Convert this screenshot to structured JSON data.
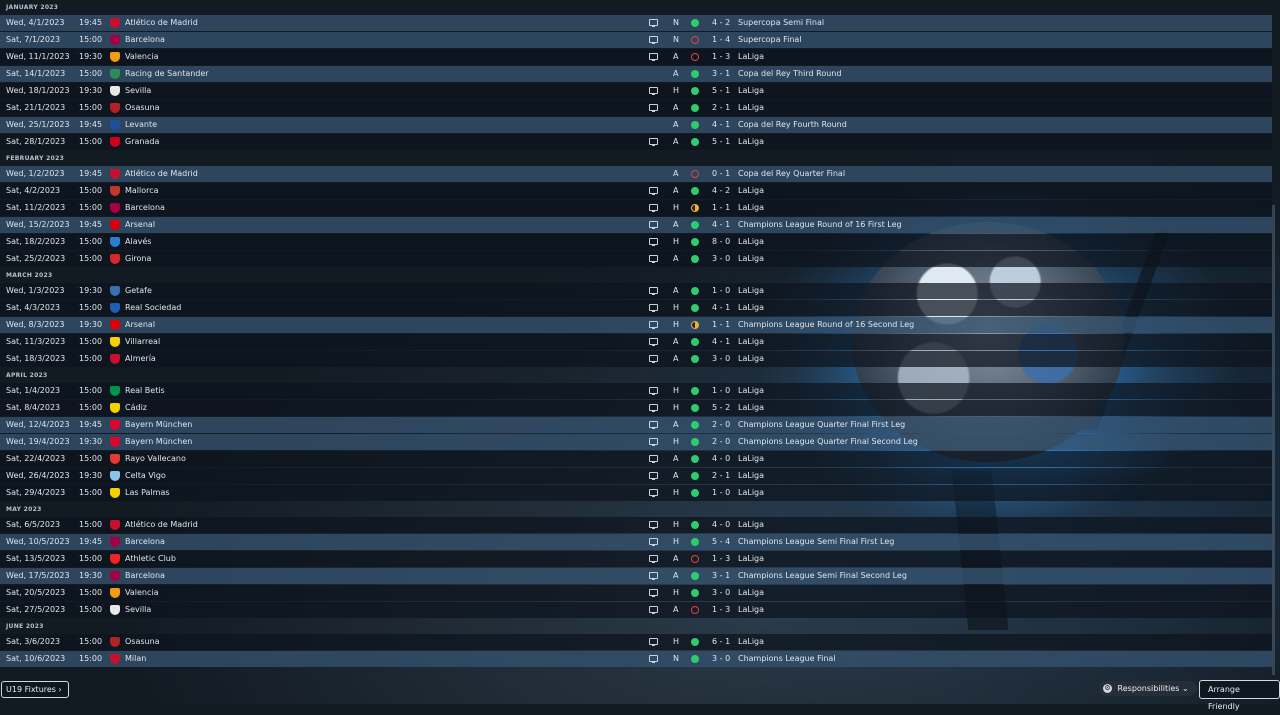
{
  "colors": {
    "win": "#2fcc6d",
    "loss": "#e0453f",
    "draw": "#f2b12a",
    "row_highlight": "#34526e"
  },
  "icons": {
    "tv": "tv-broadcast-icon",
    "win": "green-dot-icon",
    "loss": "red-ring-icon",
    "draw": "half-circle-draw-icon"
  },
  "months": [
    {
      "label": "JANUARY 2023",
      "fixtures": [
        {
          "date": "Wed, 4/1/2023",
          "time": "19:45",
          "team": "Atlético de Madrid",
          "crest": "#c8102e",
          "tv": true,
          "venue": "N",
          "result": "W",
          "score": "4 - 2",
          "competition": "Supercopa Semi Final",
          "highlight": true
        },
        {
          "date": "Sat, 7/1/2023",
          "time": "15:00",
          "team": "Barcelona",
          "crest": "#a50044",
          "tv": true,
          "venue": "N",
          "result": "L",
          "score": "1 - 4",
          "competition": "Supercopa Final",
          "highlight": true
        },
        {
          "date": "Wed, 11/1/2023",
          "time": "19:30",
          "team": "Valencia",
          "crest": "#f39c12",
          "tv": true,
          "venue": "A",
          "result": "L",
          "score": "1 - 3",
          "competition": "LaLiga",
          "highlight": false
        },
        {
          "date": "Sat, 14/1/2023",
          "time": "15:00",
          "team": "Racing de Santander",
          "crest": "#2e8b57",
          "tv": false,
          "venue": "A",
          "result": "W",
          "score": "3 - 1",
          "competition": "Copa del Rey Third Round",
          "highlight": true
        },
        {
          "date": "Wed, 18/1/2023",
          "time": "19:30",
          "team": "Sevilla",
          "crest": "#e8e8e8",
          "tv": true,
          "venue": "H",
          "result": "W",
          "score": "5 - 1",
          "competition": "LaLiga",
          "highlight": false
        },
        {
          "date": "Sat, 21/1/2023",
          "time": "15:00",
          "team": "Osasuna",
          "crest": "#b22222",
          "tv": true,
          "venue": "A",
          "result": "W",
          "score": "2 - 1",
          "competition": "LaLiga",
          "highlight": false
        },
        {
          "date": "Wed, 25/1/2023",
          "time": "19:45",
          "team": "Levante",
          "crest": "#1f4e9c",
          "tv": false,
          "venue": "A",
          "result": "W",
          "score": "4 - 1",
          "competition": "Copa del Rey Fourth Round",
          "highlight": true
        },
        {
          "date": "Sat, 28/1/2023",
          "time": "15:00",
          "team": "Granada",
          "crest": "#d0021b",
          "tv": true,
          "venue": "A",
          "result": "W",
          "score": "5 - 1",
          "competition": "LaLiga",
          "highlight": false
        }
      ]
    },
    {
      "label": "FEBRUARY 2023",
      "fixtures": [
        {
          "date": "Wed, 1/2/2023",
          "time": "19:45",
          "team": "Atlético de Madrid",
          "crest": "#c8102e",
          "tv": false,
          "venue": "A",
          "result": "L",
          "score": "0 - 1",
          "competition": "Copa del Rey Quarter Final",
          "highlight": true
        },
        {
          "date": "Sat, 4/2/2023",
          "time": "15:00",
          "team": "Mallorca",
          "crest": "#c0392b",
          "tv": true,
          "venue": "A",
          "result": "W",
          "score": "4 - 2",
          "competition": "LaLiga",
          "highlight": false
        },
        {
          "date": "Sat, 11/2/2023",
          "time": "15:00",
          "team": "Barcelona",
          "crest": "#a50044",
          "tv": true,
          "venue": "H",
          "result": "D",
          "score": "1 - 1",
          "competition": "LaLiga",
          "highlight": false
        },
        {
          "date": "Wed, 15/2/2023",
          "time": "19:45",
          "team": "Arsenal",
          "crest": "#db0007",
          "tv": true,
          "venue": "A",
          "result": "W",
          "score": "4 - 1",
          "competition": "Champions League Round of 16  First Leg",
          "highlight": true
        },
        {
          "date": "Sat, 18/2/2023",
          "time": "15:00",
          "team": "Alavés",
          "crest": "#2a7fd4",
          "tv": true,
          "venue": "H",
          "result": "W",
          "score": "8 - 0",
          "competition": "LaLiga",
          "highlight": false
        },
        {
          "date": "Sat, 25/2/2023",
          "time": "15:00",
          "team": "Girona",
          "crest": "#d62828",
          "tv": true,
          "venue": "A",
          "result": "W",
          "score": "3 - 0",
          "competition": "LaLiga",
          "highlight": false
        }
      ]
    },
    {
      "label": "MARCH 2023",
      "fixtures": [
        {
          "date": "Wed, 1/3/2023",
          "time": "19:30",
          "team": "Getafe",
          "crest": "#3a6fb0",
          "tv": true,
          "venue": "A",
          "result": "W",
          "score": "1 - 0",
          "competition": "LaLiga",
          "highlight": false
        },
        {
          "date": "Sat, 4/3/2023",
          "time": "15:00",
          "team": "Real Sociedad",
          "crest": "#1d5fb4",
          "tv": true,
          "venue": "H",
          "result": "W",
          "score": "4 - 1",
          "competition": "LaLiga",
          "highlight": false
        },
        {
          "date": "Wed, 8/3/2023",
          "time": "19:30",
          "team": "Arsenal",
          "crest": "#db0007",
          "tv": true,
          "venue": "H",
          "result": "D",
          "score": "1 - 1",
          "competition": "Champions League Round of 16  Second Leg",
          "highlight": true
        },
        {
          "date": "Sat, 11/3/2023",
          "time": "15:00",
          "team": "Villarreal",
          "crest": "#f7d000",
          "tv": true,
          "venue": "A",
          "result": "W",
          "score": "4 - 1",
          "competition": "LaLiga",
          "highlight": false
        },
        {
          "date": "Sat, 18/3/2023",
          "time": "15:00",
          "team": "Almería",
          "crest": "#c8102e",
          "tv": true,
          "venue": "A",
          "result": "W",
          "score": "3 - 0",
          "competition": "LaLiga",
          "highlight": false
        }
      ]
    },
    {
      "label": "APRIL 2023",
      "fixtures": [
        {
          "date": "Sat, 1/4/2023",
          "time": "15:00",
          "team": "Real Betis",
          "crest": "#00954c",
          "tv": true,
          "venue": "H",
          "result": "W",
          "score": "1 - 0",
          "competition": "LaLiga",
          "highlight": false
        },
        {
          "date": "Sat, 8/4/2023",
          "time": "15:00",
          "team": "Cádiz",
          "crest": "#f5d200",
          "tv": true,
          "venue": "H",
          "result": "W",
          "score": "5 - 2",
          "competition": "LaLiga",
          "highlight": false
        },
        {
          "date": "Wed, 12/4/2023",
          "time": "19:45",
          "team": "Bayern München",
          "crest": "#dc052d",
          "tv": true,
          "venue": "A",
          "result": "W",
          "score": "2 - 0",
          "competition": "Champions League Quarter Final First Leg",
          "highlight": true
        },
        {
          "date": "Wed, 19/4/2023",
          "time": "19:30",
          "team": "Bayern München",
          "crest": "#dc052d",
          "tv": true,
          "venue": "H",
          "result": "W",
          "score": "2 - 0",
          "competition": "Champions League Quarter Final Second Leg",
          "highlight": true
        },
        {
          "date": "Sat, 22/4/2023",
          "time": "15:00",
          "team": "Rayo Vallecano",
          "crest": "#e53935",
          "tv": true,
          "venue": "A",
          "result": "W",
          "score": "4 - 0",
          "competition": "LaLiga",
          "highlight": false
        },
        {
          "date": "Wed, 26/4/2023",
          "time": "19:30",
          "team": "Celta Vigo",
          "crest": "#8ac4e8",
          "tv": true,
          "venue": "A",
          "result": "W",
          "score": "2 - 1",
          "competition": "LaLiga",
          "highlight": false
        },
        {
          "date": "Sat, 29/4/2023",
          "time": "15:00",
          "team": "Las Palmas",
          "crest": "#f5d200",
          "tv": true,
          "venue": "H",
          "result": "W",
          "score": "1 - 0",
          "competition": "LaLiga",
          "highlight": false
        }
      ]
    },
    {
      "label": "MAY 2023",
      "fixtures": [
        {
          "date": "Sat, 6/5/2023",
          "time": "15:00",
          "team": "Atlético de Madrid",
          "crest": "#c8102e",
          "tv": true,
          "venue": "H",
          "result": "W",
          "score": "4 - 0",
          "competition": "LaLiga",
          "highlight": false
        },
        {
          "date": "Wed, 10/5/2023",
          "time": "19:45",
          "team": "Barcelona",
          "crest": "#a50044",
          "tv": true,
          "venue": "H",
          "result": "W",
          "score": "5 - 4",
          "competition": "Champions League Semi Final First Leg",
          "highlight": true
        },
        {
          "date": "Sat, 13/5/2023",
          "time": "15:00",
          "team": "Athletic Club",
          "crest": "#ee2523",
          "tv": true,
          "venue": "A",
          "result": "L",
          "score": "1 - 3",
          "competition": "LaLiga",
          "highlight": false
        },
        {
          "date": "Wed, 17/5/2023",
          "time": "19:30",
          "team": "Barcelona",
          "crest": "#a50044",
          "tv": true,
          "venue": "A",
          "result": "W",
          "score": "3 - 1",
          "competition": "Champions League Semi Final Second Leg",
          "highlight": true
        },
        {
          "date": "Sat, 20/5/2023",
          "time": "15:00",
          "team": "Valencia",
          "crest": "#f39c12",
          "tv": true,
          "venue": "H",
          "result": "W",
          "score": "3 - 0",
          "competition": "LaLiga",
          "highlight": false
        },
        {
          "date": "Sat, 27/5/2023",
          "time": "15:00",
          "team": "Sevilla",
          "crest": "#e8e8e8",
          "tv": true,
          "venue": "A",
          "result": "L",
          "score": "1 - 3",
          "competition": "LaLiga",
          "highlight": false
        }
      ]
    },
    {
      "label": "JUNE 2023",
      "fixtures": [
        {
          "date": "Sat, 3/6/2023",
          "time": "15:00",
          "team": "Osasuna",
          "crest": "#b22222",
          "tv": true,
          "venue": "H",
          "result": "W",
          "score": "6 - 1",
          "competition": "LaLiga",
          "highlight": false
        },
        {
          "date": "Sat, 10/6/2023",
          "time": "15:00",
          "team": "Milan",
          "crest": "#c8102e",
          "tv": true,
          "venue": "N",
          "result": "W",
          "score": "3 - 0",
          "competition": "Champions League Final",
          "highlight": true
        }
      ]
    }
  ],
  "bottom_bar": {
    "u19_label": "U19 Fixtures",
    "u19_chevron": "›",
    "responsibilities_label": "Responsibilities",
    "responsibilities_chevron": "⌄",
    "arrange_label": "Arrange Friendly"
  }
}
